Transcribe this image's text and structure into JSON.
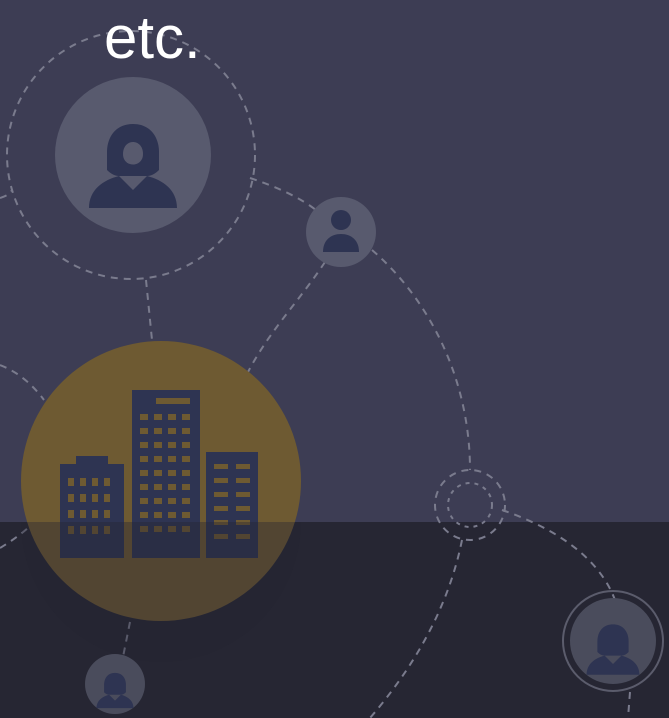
{
  "caption": "etc.",
  "colors": {
    "background_top": "#3d3d54",
    "background_bottom": "#262633",
    "node_fill": "#585a6e",
    "icon_fill": "#2e3452",
    "building_fill": "#6e5a32",
    "dash_stroke": "#7a7b8d"
  },
  "icons": {
    "large_person": "woman-icon",
    "small_person": "man-icon",
    "building": "office-buildings-icon",
    "bottom_person": "woman-icon",
    "right_person": "woman-icon"
  }
}
